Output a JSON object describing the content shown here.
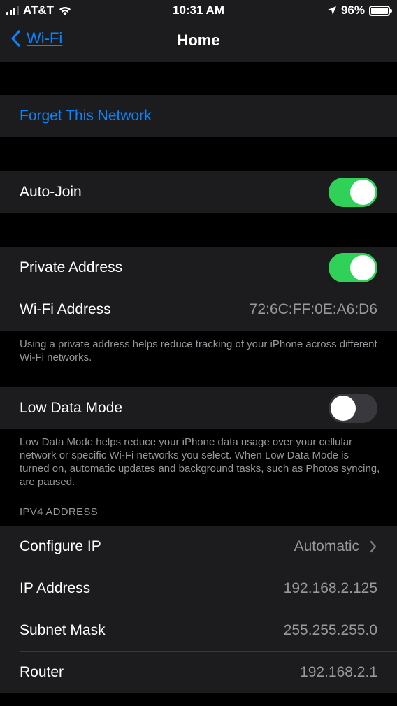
{
  "status_bar": {
    "carrier": "AT&T",
    "time": "10:31 AM",
    "battery": "96%"
  },
  "nav": {
    "back_label": "Wi-Fi",
    "title": "Home"
  },
  "forget": {
    "label": "Forget This Network"
  },
  "auto_join": {
    "label": "Auto-Join",
    "enabled": true
  },
  "privacy": {
    "private_address_label": "Private Address",
    "private_address_enabled": true,
    "wifi_address_label": "Wi-Fi Address",
    "wifi_address_value": "72:6C:FF:0E:A6:D6",
    "footnote": "Using a private address helps reduce tracking of your iPhone across different Wi-Fi networks."
  },
  "low_data": {
    "label": "Low Data Mode",
    "enabled": false,
    "footnote": "Low Data Mode helps reduce your iPhone data usage over your cellular network or specific Wi-Fi networks you select. When Low Data Mode is turned on, automatic updates and background tasks, such as Photos syncing, are paused."
  },
  "ipv4": {
    "header": "IPV4 ADDRESS",
    "configure_label": "Configure IP",
    "configure_value": "Automatic",
    "ip_label": "IP Address",
    "ip_value": "192.168.2.125",
    "subnet_label": "Subnet Mask",
    "subnet_value": "255.255.255.0",
    "router_label": "Router",
    "router_value": "192.168.2.1"
  },
  "colors": {
    "accent": "#0a84ff",
    "toggle_on": "#30d158",
    "toggle_off": "#39393d",
    "cell_bg": "#1c1c1e",
    "secondary_text": "#98989d"
  },
  "icons": [
    "signal-icon",
    "wifi-icon",
    "location-icon",
    "battery-icon",
    "chevron-left-icon",
    "chevron-right-icon"
  ]
}
